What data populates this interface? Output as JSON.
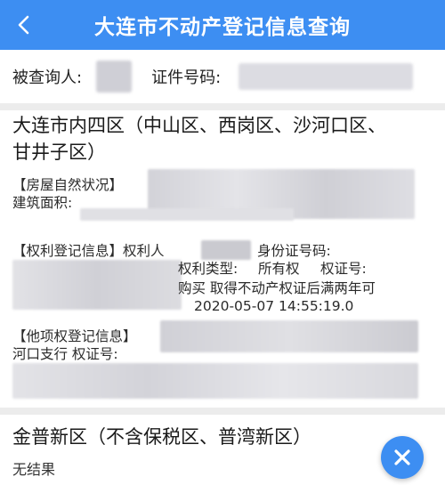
{
  "header": {
    "title": "大连市不动产登记信息查询",
    "back_icon": "chevron-left-icon"
  },
  "query": {
    "subject_label": "被查询人:",
    "id_label": "证件号码:"
  },
  "districts": [
    {
      "title_line1": "大连市内四区（中山区、西岗区、沙河口区、",
      "title_line2": "甘井子区）",
      "house_label": "【房屋自然状况】",
      "area_label": "建筑面积:",
      "rights_label": "【权利登记信息】权利人",
      "id_card_label": "身份证号码:",
      "rights_type_label": "权利类型:",
      "rights_type_value": "所有权",
      "cert_label": "权证号:",
      "purchase_note": "购买 取得不动产权证后满两年可",
      "timestamp": "2020-05-07 14:55:19.0",
      "other_rights_label": "【他项权登记信息】",
      "bank_fragment": "河口支行 权证号:"
    },
    {
      "title": "金普新区（不含保税区、普湾新区）",
      "result": "无结果"
    }
  ],
  "fab": {
    "icon": "close-icon"
  },
  "colors": {
    "header_bg": "#3d8ef2",
    "fab_bg": "#3d8ef2",
    "divider": "#ececec",
    "blur_tint": "#d4d4d8"
  }
}
